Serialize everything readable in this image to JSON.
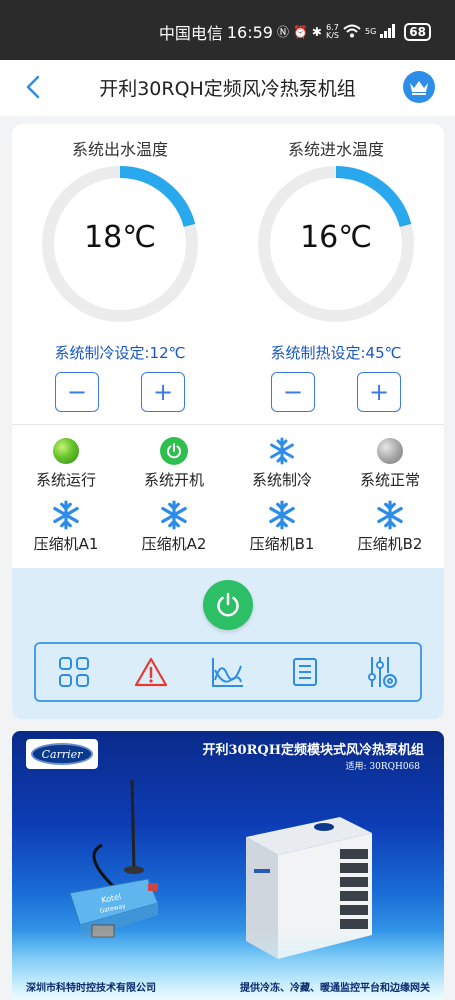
{
  "status_bar": {
    "carrier": "中国电信",
    "time": "16:59",
    "speed_top": "6.7",
    "speed_bottom": "K/S",
    "network": "5G",
    "battery": "68"
  },
  "header": {
    "title": "开利30RQH定频风冷热泵机组"
  },
  "gauges": [
    {
      "label": "系统出水温度",
      "value": "18℃",
      "setpoint": "系统制冷设定:12℃",
      "minus": "−",
      "plus": "+"
    },
    {
      "label": "系统进水温度",
      "value": "16℃",
      "setpoint": "系统制热设定:45℃",
      "minus": "−",
      "plus": "+"
    }
  ],
  "status_items": [
    {
      "label": "系统运行",
      "icon": "green-led-icon"
    },
    {
      "label": "系统开机",
      "icon": "power-on-icon"
    },
    {
      "label": "系统制冷",
      "icon": "snowflake-icon"
    },
    {
      "label": "系统正常",
      "icon": "grey-led-icon"
    },
    {
      "label": "压缩机A1",
      "icon": "snowflake-icon"
    },
    {
      "label": "压缩机A2",
      "icon": "snowflake-icon"
    },
    {
      "label": "压缩机B1",
      "icon": "snowflake-icon"
    },
    {
      "label": "压缩机B2",
      "icon": "snowflake-icon"
    }
  ],
  "toolbar": [
    "grid-icon",
    "alarm-warning-icon",
    "trend-chart-icon",
    "list-icon",
    "settings-sliders-icon"
  ],
  "banner": {
    "logo": "Carrier",
    "title": "开利30RQH定频模块式风冷热泵机组",
    "subtitle": "适用: 30RQH068",
    "footer_left": "深圳市科特时控技术有限公司",
    "footer_right": "提供冷冻、冷藏、暖通监控平台和边缘网关",
    "gateway_brand": "Kotel",
    "gateway_text": "Gateway"
  },
  "colors": {
    "accent": "#3b7be0",
    "gauge_arc": "#2aa8ee",
    "power": "#2cbf65",
    "alarm": "#e53935"
  }
}
